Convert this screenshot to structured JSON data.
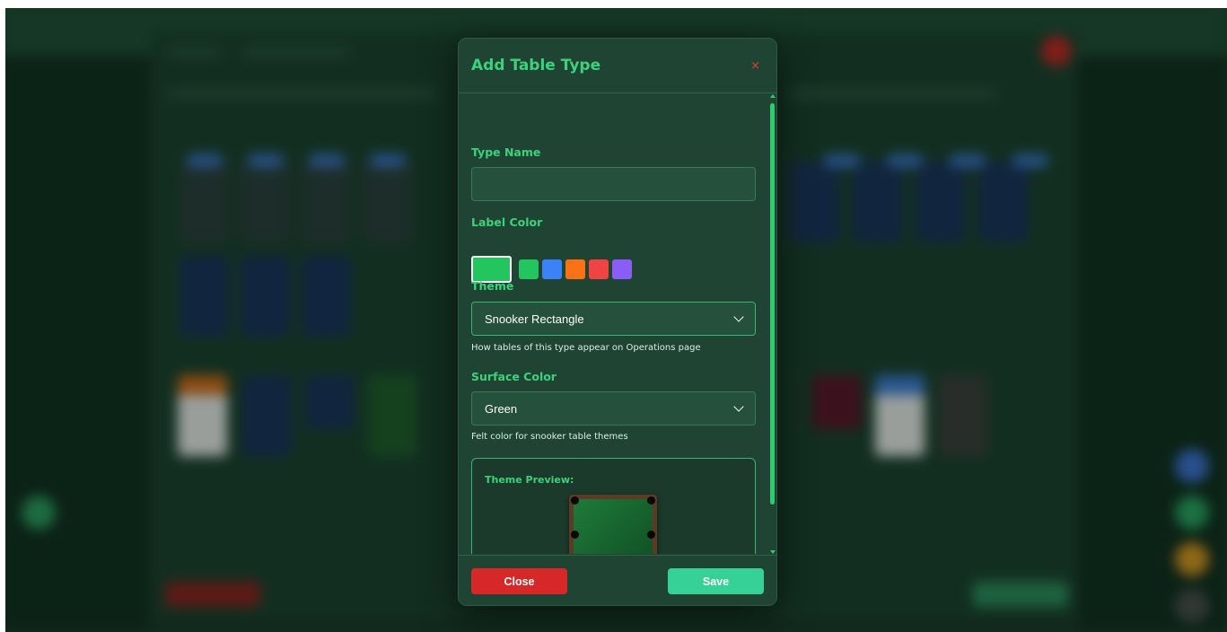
{
  "modal": {
    "title": "Add Table Type",
    "close_icon": "×",
    "type_name": {
      "label": "Type Name",
      "value": "",
      "placeholder": ""
    },
    "label_color": {
      "label": "Label Color",
      "selected": "#22c55e",
      "options": [
        "#22c55e",
        "#3b82f6",
        "#f97316",
        "#ef4444",
        "#8b5cf6"
      ]
    },
    "theme": {
      "label": "Theme",
      "selected": "Snooker Rectangle",
      "hint": "How tables of this type appear on Operations page"
    },
    "surface_color": {
      "label": "Surface Color",
      "selected": "Green",
      "hint": "Felt color for snooker table themes"
    },
    "preview": {
      "label": "Theme Preview:"
    },
    "buttons": {
      "close": "Close",
      "save": "Save"
    }
  },
  "colors": {
    "accent": "#3cd27c",
    "danger": "#d62828",
    "save": "#35d196",
    "modal_bg": "#1f4433"
  },
  "icons": {
    "close": "close-icon",
    "select_chevron": "chevron-down-icon",
    "scroll_up": "caret-up-icon",
    "scroll_down": "caret-down-icon"
  }
}
